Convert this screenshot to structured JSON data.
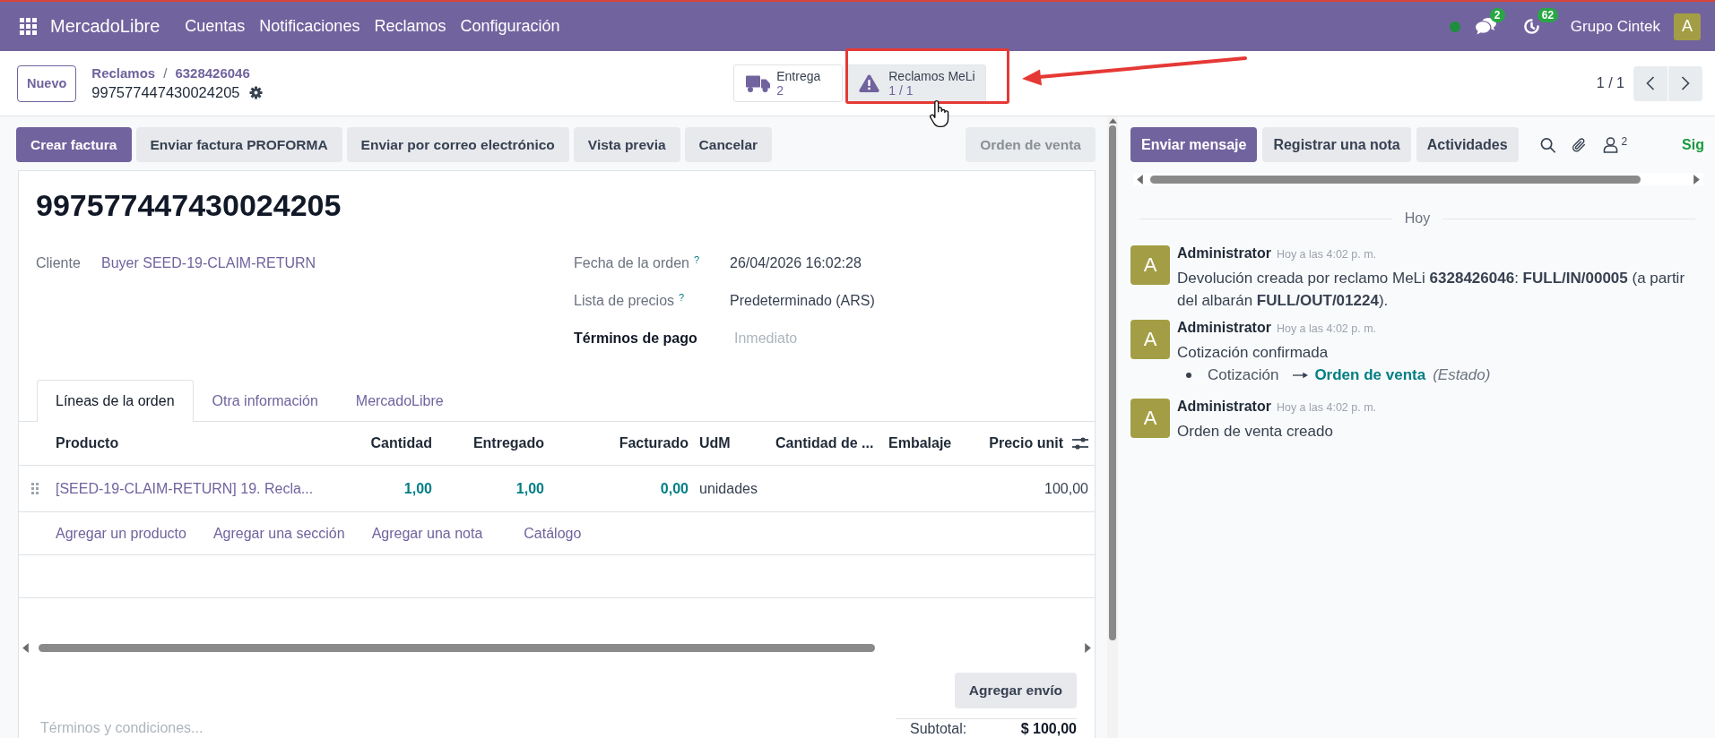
{
  "navbar": {
    "app_name": "MercadoLibre",
    "menu": [
      {
        "label": "Cuentas"
      },
      {
        "label": "Notificaciones"
      },
      {
        "label": "Reclamos"
      },
      {
        "label": "Configuración"
      }
    ],
    "online": true,
    "messages_count": "2",
    "activities_count": "62",
    "company": "Grupo Cintek",
    "avatar": "A"
  },
  "control_panel": {
    "new_button": "Nuevo",
    "breadcrumb": [
      {
        "label": "Reclamos"
      },
      {
        "label": "6328426046"
      }
    ],
    "breadcrumb_separator": "/",
    "record_name": "997577447430024205",
    "smart_buttons": [
      {
        "kind": "delivery",
        "label": "Entrega",
        "value": "2",
        "hovered": false
      },
      {
        "kind": "claims",
        "label": "Reclamos MeLi",
        "value": "1 / 1",
        "hovered": true
      }
    ],
    "pager": "1 / 1"
  },
  "form": {
    "action_buttons": [
      {
        "label": "Crear factura",
        "kind": "primary"
      },
      {
        "label": "Enviar factura PROFORMA",
        "kind": "secondary"
      },
      {
        "label": "Enviar por correo electrónico",
        "kind": "secondary"
      },
      {
        "label": "Vista previa",
        "kind": "secondary"
      },
      {
        "label": "Cancelar",
        "kind": "secondary"
      }
    ],
    "status_bar": [
      {
        "label": "Orden de venta"
      }
    ],
    "title": "997577447430024205",
    "fields_left": [
      {
        "label": "Cliente",
        "kind": "link",
        "value": "Buyer SEED-19-CLAIM-RETURN",
        "readonly": true
      }
    ],
    "fields_right": [
      {
        "label": "Fecha de la orden",
        "help": "?",
        "kind": "text",
        "value": "26/04/2026 16:02:28",
        "readonly": true
      },
      {
        "label": "Lista de precios",
        "help": "?",
        "kind": "text",
        "value": "Predeterminado (ARS)",
        "readonly": true
      },
      {
        "label": "Términos de pago",
        "kind": "input",
        "placeholder": "Inmediato",
        "readonly": false
      }
    ],
    "tabs": [
      {
        "label": "Líneas de la orden",
        "selected": true
      },
      {
        "label": "Otra información",
        "selected": false
      },
      {
        "label": "MercadoLibre",
        "selected": false
      }
    ],
    "order_lines": {
      "columns": [
        {
          "label": "Producto",
          "kind": "link"
        },
        {
          "label": "Cantidad",
          "kind": "quantity"
        },
        {
          "label": "Entregado",
          "kind": "quantity"
        },
        {
          "label": "Facturado",
          "kind": "quantity"
        },
        {
          "label": "UdM",
          "kind": "text"
        },
        {
          "label": "Cantidad de ...",
          "kind": "text"
        },
        {
          "label": "Embalaje",
          "kind": "text"
        },
        {
          "label": "Precio unit",
          "kind": "amount"
        }
      ],
      "rows": [
        {
          "cells": [
            "[SEED-19-CLAIM-RETURN] 19. Recla...",
            "1,00",
            "1,00",
            "0,00",
            "unidades",
            null,
            null,
            "100,00"
          ]
        }
      ],
      "add_links": [
        {
          "label": "Agregar un producto"
        },
        {
          "label": "Agregar una sección"
        },
        {
          "label": "Agregar una nota"
        },
        {
          "label": "Catálogo"
        }
      ]
    },
    "shipping_button": "Agregar envío",
    "terms_placeholder": "Términos y condiciones...",
    "subtotal": {
      "label": "Subtotal:",
      "value": "$ 100,00"
    }
  },
  "chatter": {
    "buttons": [
      {
        "label": "Enviar mensaje",
        "kind": "primary"
      },
      {
        "label": "Registrar una nota",
        "kind": "secondary"
      },
      {
        "label": "Actividades",
        "kind": "secondary"
      }
    ],
    "followers_count": "2",
    "follow_label": "Sig",
    "date_separator": "Hoy",
    "messages": [
      {
        "avatar": "A",
        "author": "Administrator",
        "time": "Hoy a las 4:02 p. m.",
        "body": "Devolución creada por reclamo MeLi **6328426046**: **FULL/IN/00005** (a partir del albarán **FULL/OUT/01224**)."
      },
      {
        "avatar": "A",
        "author": "Administrator",
        "time": "Hoy a las 4:02 p. m.",
        "body": "Cotización confirmada",
        "tracking": [
          {
            "old": "Cotización",
            "new": "Orden de venta",
            "field": "(Estado)"
          }
        ]
      },
      {
        "avatar": "A",
        "author": "Administrator",
        "time": "Hoy a las 4:02 p. m.",
        "body": "Orden de venta creado"
      }
    ]
  }
}
